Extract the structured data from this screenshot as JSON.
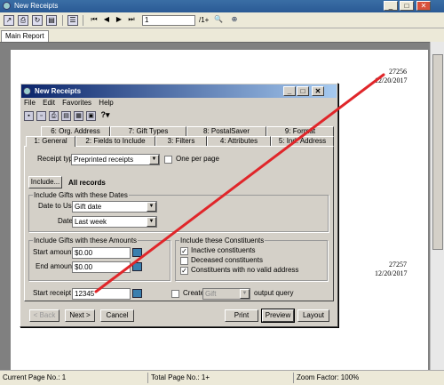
{
  "window": {
    "title": "New Receipts"
  },
  "window_buttons": {
    "minimize": "_",
    "maximize": "□",
    "close": "✕"
  },
  "toolbar": {
    "page_value": "1",
    "page_total": "/1+"
  },
  "tabs": {
    "main_report": "Main Report"
  },
  "report": {
    "receipt1_number": "27256",
    "receipt1_date": "12/20/2017",
    "receipt2_number": "27257",
    "receipt2_date": "12/20/2017"
  },
  "status": {
    "current_page": "Current Page No.: 1",
    "total_page": "Total Page No.: 1+",
    "zoom": "Zoom Factor: 100%"
  },
  "dialog": {
    "title": "New Receipts",
    "menu": [
      "File",
      "Edit",
      "Favorites",
      "Help"
    ],
    "tabs_back": [
      "6: Org. Address",
      "7: Gift Types",
      "8: PostalSaver",
      "9: Format"
    ],
    "tabs_front": [
      "1: General",
      "2: Fields to Include",
      "3: Filters",
      "4: Attributes",
      "5: Ind. Address"
    ],
    "receipt_type_label": "Receipt type:",
    "receipt_type_value": "Preprinted receipts",
    "one_per_page_label": "One per page",
    "include_button": "Include...",
    "all_records": "All records",
    "gifts_dates_group": "Include Gifts with these Dates",
    "date_to_use_label": "Date to Use:",
    "date_to_use_value": "Gift date",
    "date_label": "Date:",
    "date_value": "Last week",
    "amounts_group": "Include Gifts with these Amounts",
    "start_amount_label": "Start amount:",
    "start_amount_value": "$0.00",
    "end_amount_label": "End amount:",
    "end_amount_value": "$0.00",
    "constituents_group": "Include these Constituents",
    "inactive_label": "Inactive constituents",
    "inactive_checked": true,
    "deceased_label": "Deceased constituents",
    "deceased_checked": false,
    "no_address_label": "Constituents with no valid address",
    "no_address_checked": true,
    "start_receipt_label": "Start receipt no.:",
    "start_receipt_value": "12345",
    "create_label": "Create",
    "create_value": "Gift",
    "output_query_label": "output query",
    "buttons": {
      "back": "< Back",
      "next": "Next >",
      "cancel": "Cancel",
      "print": "Print",
      "preview": "Preview",
      "layout": "Layout"
    }
  },
  "annotation": {
    "color": "#e0262a"
  }
}
